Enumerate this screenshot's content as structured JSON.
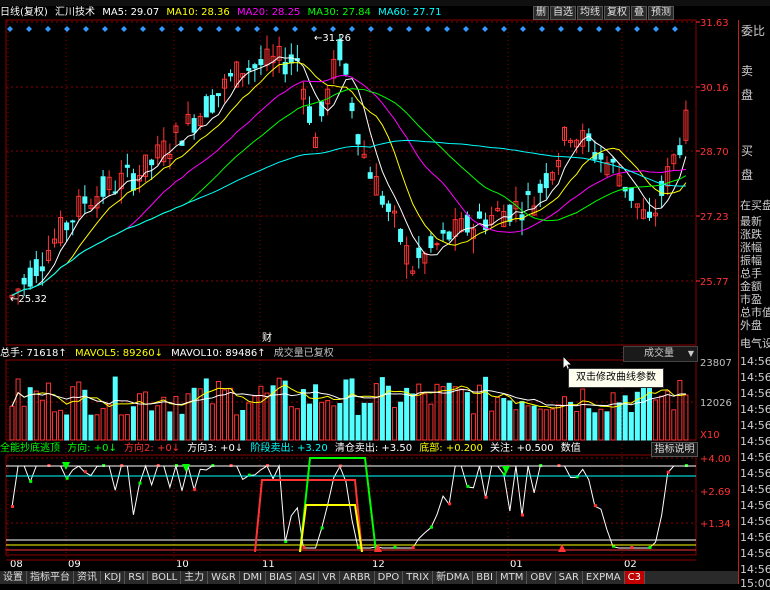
{
  "title": {
    "period": "日线(复权)",
    "stock": "汇川技术"
  },
  "ma": [
    {
      "label": "MA5: 29.07",
      "color": "#ffffff"
    },
    {
      "label": "MA10: 28.36",
      "color": "#ffff00"
    },
    {
      "label": "MA20: 28.25",
      "color": "#ff00ff"
    },
    {
      "label": "MA30: 27.84",
      "color": "#00ff00"
    },
    {
      "label": "MA60: 27.71",
      "color": "#00ffff"
    }
  ],
  "tools": [
    "删",
    "自选",
    "均线",
    "复权",
    "叠",
    "预测"
  ],
  "price_axis": [
    "31.63",
    "30.16",
    "28.70",
    "27.23",
    "25.77"
  ],
  "labels": {
    "high": "31.26",
    "low": "25.32",
    "finance": "财"
  },
  "x_axis": [
    "08",
    "09",
    "10",
    "11",
    "12",
    "01",
    "02"
  ],
  "volume": {
    "row": [
      {
        "t": "总手: 71618↑",
        "c": "#ffffff"
      },
      {
        "t": "MAVOL5: 89260↓",
        "c": "#ffff00"
      },
      {
        "t": "MAVOL10: 89486↑",
        "c": "#ffffff"
      },
      {
        "t": "成交量已复权",
        "c": "#c0c0c0"
      }
    ],
    "dropdown": "成交量",
    "axis": [
      "23807",
      "12026",
      "X10"
    ]
  },
  "tooltip": "双击修改曲线参数",
  "indicator": {
    "row": [
      {
        "t": "全能抄底逃顶",
        "c": "#00ff00"
      },
      {
        "t": "方向: +0↓",
        "c": "#00ff00"
      },
      {
        "t": "方向2: +0↓",
        "c": "#ff3030"
      },
      {
        "t": "方向3: +0↓",
        "c": "#ffffff"
      },
      {
        "t": "阶段卖出: +3.20",
        "c": "#00ffff"
      },
      {
        "t": "清仓卖出: +3.50",
        "c": "#ffffff"
      },
      {
        "t": "底部: +0.200",
        "c": "#ffff00"
      },
      {
        "t": "关注: +0.500",
        "c": "#ffffff"
      },
      {
        "t": "数值",
        "c": "#ffffff"
      }
    ],
    "button": "指标说明",
    "axis": [
      "+4.00",
      "+2.69",
      "+1.34"
    ]
  },
  "right_panel": {
    "top": [
      "委比",
      "卖",
      "盘",
      "买",
      "盘"
    ],
    "mid": [
      "在买盘",
      "最新",
      "涨跌",
      "涨幅",
      "振幅",
      "总手",
      "金额",
      "市盈",
      "总市值",
      "外盘",
      "电气设"
    ],
    "times": [
      "14:56",
      "14:56",
      "14:56",
      "14:56",
      "14:56",
      "14:56",
      "14:56",
      "14:56",
      "14:56",
      "14:56",
      "14:56",
      "14:56",
      "14:56",
      "14:56",
      "15:00"
    ]
  },
  "tabs": [
    "设置",
    "指标平台",
    "资讯",
    "KDJ",
    "RSI",
    "BOLL",
    "主力",
    "W&R",
    "DMI",
    "BIAS",
    "ASI",
    "VR",
    "ARBR",
    "DPO",
    "TRIX",
    "新DMA",
    "BBI",
    "MTM",
    "OBV",
    "SAR",
    "EXPMA",
    "C3"
  ],
  "colors": {
    "up": "#ff3333",
    "down": "#54ffff",
    "grid": "#8b0000",
    "panel_border": "#c02020"
  }
}
